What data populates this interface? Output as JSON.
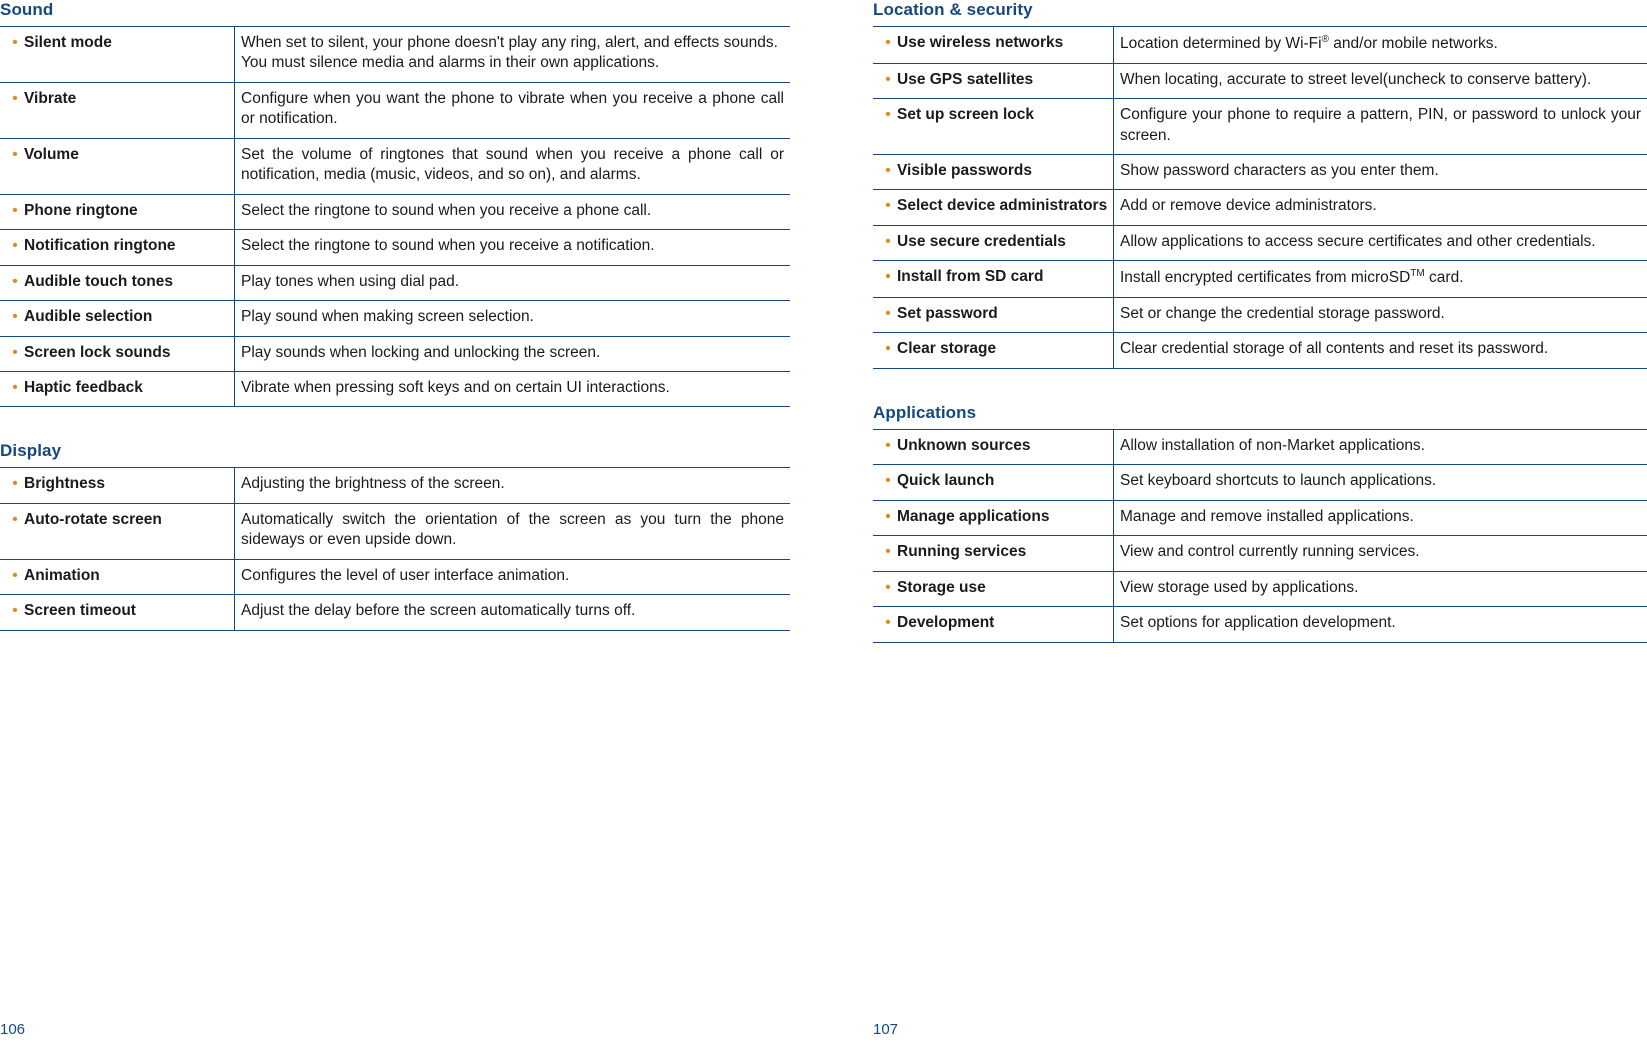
{
  "left_column": {
    "sections": [
      {
        "title": "Sound",
        "rows": [
          {
            "term": "Silent mode",
            "desc": "When set to silent, your phone doesn't play any ring, alert, and effects sounds.\nYou must silence media and alarms in their own applications.",
            "justify": false
          },
          {
            "term": "Vibrate",
            "desc": "Configure when you want the phone to vibrate when you receive a phone call or notification.",
            "justify": true
          },
          {
            "term": "Volume",
            "desc": "Set the volume of ringtones that sound when you receive a phone call or notification, media (music, videos, and so on), and alarms.",
            "justify": true
          },
          {
            "term": "Phone ringtone",
            "desc": "Select the ringtone to sound when you receive a phone call.",
            "justify": false
          },
          {
            "term": "Notification ringtone",
            "desc": "Select the ringtone to sound when you receive a notification.",
            "justify": false
          },
          {
            "term": "Audible touch tones",
            "desc": "Play tones when using dial pad.",
            "justify": false
          },
          {
            "term": "Audible selection",
            "desc": "Play sound when making screen selection.",
            "justify": false
          },
          {
            "term": "Screen lock sounds",
            "desc": "Play sounds when locking and unlocking the screen.",
            "justify": false
          },
          {
            "term": "Haptic feedback",
            "desc": "Vibrate when pressing soft keys and on certain UI interactions.",
            "justify": false
          }
        ]
      },
      {
        "title": "Display",
        "rows": [
          {
            "term": "Brightness",
            "desc": "Adjusting the brightness of the screen.",
            "justify": false
          },
          {
            "term": "Auto-rotate screen",
            "desc": "Automatically switch the orientation of the screen as you turn the phone sideways or even upside down.",
            "justify": true
          },
          {
            "term": "Animation",
            "desc": "Configures the level of user interface animation.",
            "justify": false
          },
          {
            "term": "Screen timeout",
            "desc": "Adjust the delay before the screen automatically turns off.",
            "justify": false
          }
        ]
      }
    ],
    "page_number": "106"
  },
  "right_column": {
    "sections": [
      {
        "title": "Location & security",
        "rows": [
          {
            "term": "Use wireless networks",
            "desc": "Location determined by Wi-Fi® and/or mobile networks.",
            "justify": false
          },
          {
            "term": "Use GPS satellites",
            "desc": "When locating, accurate to street level(uncheck to conserve battery).",
            "justify": true
          },
          {
            "term": "Set up screen lock",
            "desc": "Configure your phone to require a pattern, PIN, or password to unlock your screen.",
            "justify": true
          },
          {
            "term": "Visible passwords",
            "desc": "Show password characters as you enter them.",
            "justify": false
          },
          {
            "term": "Select device administrators",
            "desc": "Add or remove device administrators.",
            "justify": false
          },
          {
            "term": "Use secure credentials",
            "desc": "Allow applications to access secure certificates and other credentials.",
            "justify": true
          },
          {
            "term": "Install from SD card",
            "desc": "Install encrypted certificates from microSDTM card.",
            "justify": false
          },
          {
            "term": "Set password",
            "desc": "Set or change the credential storage password.",
            "justify": false
          },
          {
            "term": "Clear storage",
            "desc": "Clear credential storage of all contents and reset its password.",
            "justify": false
          }
        ]
      },
      {
        "title": "Applications",
        "rows": [
          {
            "term": "Unknown sources",
            "desc": "Allow installation of non-Market applications.",
            "justify": false
          },
          {
            "term": "Quick launch",
            "desc": "Set keyboard shortcuts to launch applications.",
            "justify": false
          },
          {
            "term": "Manage applications",
            "desc": "Manage and remove installed applications.",
            "justify": false
          },
          {
            "term": "Running services",
            "desc": "View and control currently running services.",
            "justify": false
          },
          {
            "term": "Storage use",
            "desc": "View storage used by applications.",
            "justify": false
          },
          {
            "term": "Development",
            "desc": "Set options for application development.",
            "justify": false
          }
        ]
      }
    ],
    "page_number": "107"
  },
  "colors": {
    "heading_blue": "#15487e",
    "bullet_orange": "#e08a1e",
    "rule_blue": "#15487e"
  },
  "bullet_glyph": "•"
}
